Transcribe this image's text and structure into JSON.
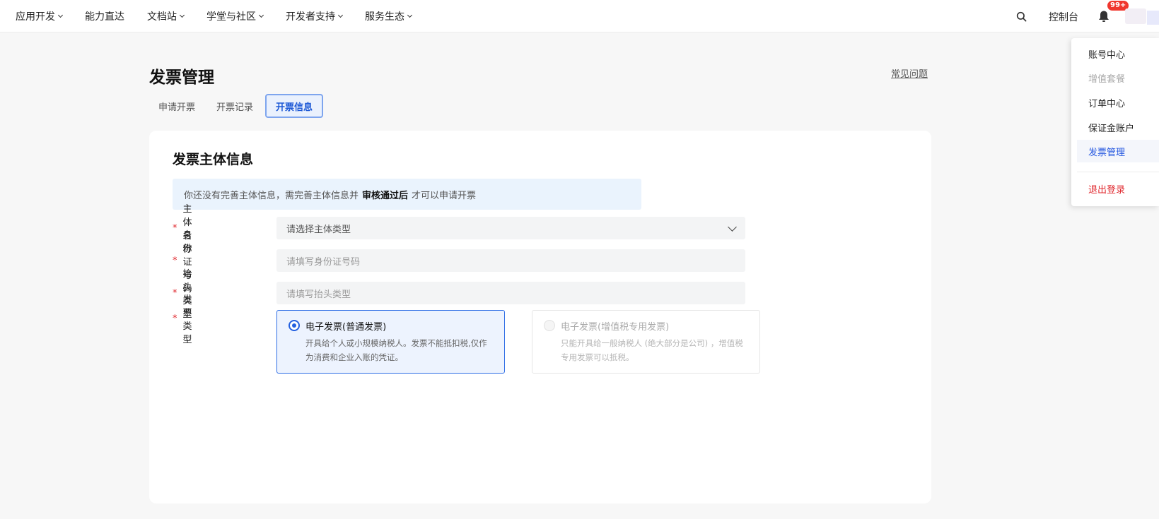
{
  "nav": {
    "items": [
      {
        "label": "应用开发",
        "has_caret": true
      },
      {
        "label": "能力直达",
        "has_caret": false
      },
      {
        "label": "文档站",
        "has_caret": true
      },
      {
        "label": "学堂与社区",
        "has_caret": true
      },
      {
        "label": "开发者支持",
        "has_caret": true
      },
      {
        "label": "服务生态",
        "has_caret": true
      }
    ],
    "console_label": "控制台",
    "notification_badge": "99+"
  },
  "page": {
    "title": "发票管理",
    "faq_link": "常见问题"
  },
  "tabs": [
    {
      "label": "申请开票",
      "active": false
    },
    {
      "label": "开票记录",
      "active": false
    },
    {
      "label": "开票信息",
      "active": true
    }
  ],
  "section": {
    "title": "发票主体信息",
    "notice_prefix": "你还没有完善主体信息，需完善主体信息并",
    "notice_bold": "审核通过后",
    "notice_suffix": "才可以申请开票"
  },
  "form": {
    "entity_name": {
      "label": "主体名称",
      "value": "请选择主体类型"
    },
    "id_number": {
      "label": "身份证号码",
      "placeholder": "请填写身份证号码"
    },
    "header_type": {
      "label": "抬头类型",
      "placeholder": "请填写抬头类型"
    },
    "invoice_type": {
      "label": "发票类型",
      "options": [
        {
          "title": "电子发票(普通发票)",
          "desc": "开具给个人或小规模纳税人。发票不能抵扣税,仅作为消费和企业入账的凭证。",
          "selected": true,
          "disabled": false
        },
        {
          "title": "电子发票(增值税专用发票)",
          "desc": "只能开具给一般纳税人 (绝大部分是公司) ，增值税专用发票可以抵税。",
          "selected": false,
          "disabled": true
        }
      ]
    }
  },
  "account_menu": {
    "items": [
      {
        "label": "账号中心",
        "state": "normal"
      },
      {
        "label": "增值套餐",
        "state": "disabled"
      },
      {
        "label": "订单中心",
        "state": "normal"
      },
      {
        "label": "保证金账户",
        "state": "normal"
      },
      {
        "label": "发票管理",
        "state": "active"
      },
      {
        "label": "退出登录",
        "state": "logout"
      }
    ]
  },
  "colors": {
    "primary": "#2360e0",
    "danger": "#e0282e",
    "notice_bg": "#eaf3fd"
  }
}
